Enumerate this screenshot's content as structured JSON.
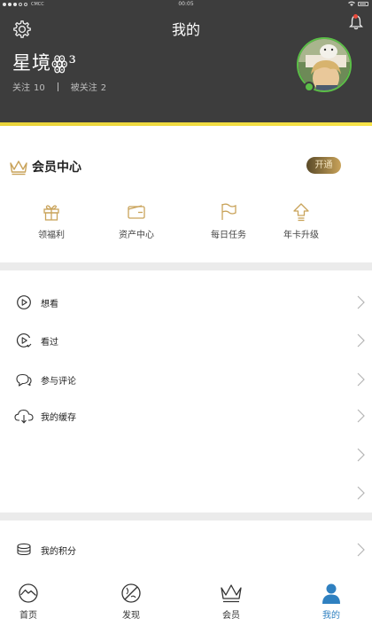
{
  "statusbar": {
    "carrier": "CMCC",
    "time": "00:05"
  },
  "header": {
    "title": "我的",
    "username": "星境ꙮ³",
    "following_label": "关注",
    "following_count": "10",
    "followers_label": "被关注",
    "followers_count": "2",
    "accent_color": "#f2dc3a"
  },
  "member": {
    "title": "会员中心",
    "open_button": "开通",
    "perks": [
      {
        "label": "领福利",
        "icon": "gift-icon"
      },
      {
        "label": "资产中心",
        "icon": "wallet-icon"
      },
      {
        "label": "每日任务",
        "icon": "flag-icon"
      },
      {
        "label": "年卡升级",
        "icon": "upgrade-arrow-icon"
      }
    ],
    "gold_color": "#c9a35a"
  },
  "list": [
    {
      "label": "想看",
      "icon": "play-circle-icon"
    },
    {
      "label": "看过",
      "icon": "play-check-icon"
    },
    {
      "label": "参与评论",
      "icon": "chat-bubbles-icon"
    },
    {
      "label": "我的缓存",
      "icon": "cloud-download-icon"
    },
    {
      "label": "",
      "icon": ""
    },
    {
      "label": "",
      "icon": ""
    }
  ],
  "list2": [
    {
      "label": "我的积分",
      "icon": "coins-icon"
    }
  ],
  "tabbar": {
    "active_color": "#2f80c0",
    "tabs": [
      {
        "label": "首页",
        "icon": "home-wave-icon"
      },
      {
        "label": "发现",
        "icon": "planet-icon"
      },
      {
        "label": "会员",
        "icon": "crown-icon"
      },
      {
        "label": "我的",
        "icon": "person-icon",
        "active": true
      }
    ]
  }
}
